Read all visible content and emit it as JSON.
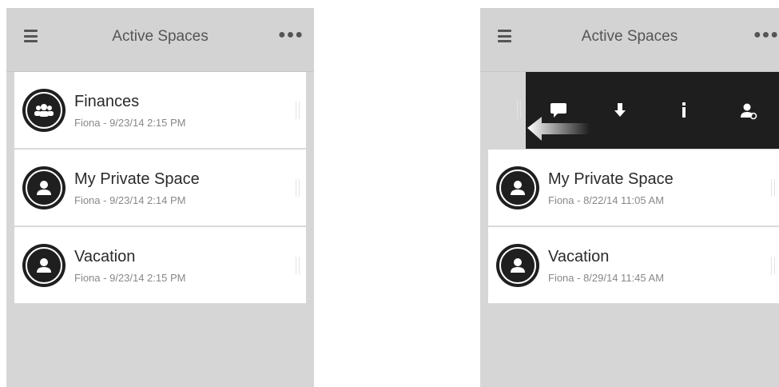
{
  "left_screen": {
    "header": {
      "title": "Active Spaces",
      "menu_icon": "hamburger-icon",
      "more_icon": "more-icon"
    },
    "spaces": [
      {
        "name": "Finances",
        "meta": "Fiona - 9/23/14 2:15 PM",
        "icon": "group-icon"
      },
      {
        "name": "My Private Space",
        "meta": "Fiona - 9/23/14 2:14 PM",
        "icon": "person-icon"
      },
      {
        "name": "Vacation",
        "meta": "Fiona - 9/23/14 2:15 PM",
        "icon": "person-icon"
      }
    ]
  },
  "right_screen": {
    "header": {
      "title": "Active Spaces",
      "menu_icon": "hamburger-icon",
      "more_icon": "more-icon"
    },
    "swipe_actions": [
      "comment-icon",
      "download-icon",
      "info-icon",
      "manage-member-icon"
    ],
    "spaces": [
      {
        "name": "My Private Space",
        "meta": "Fiona - 8/22/14 11:05 AM",
        "icon": "person-icon"
      },
      {
        "name": "Vacation",
        "meta": "Fiona - 8/29/14 11:45 AM",
        "icon": "person-icon"
      }
    ]
  },
  "colors": {
    "background": "#d6d6d6",
    "row": "#ffffff",
    "action_bar": "#1e1e1e",
    "text": "#2a2a2a",
    "subtext": "#888888"
  }
}
